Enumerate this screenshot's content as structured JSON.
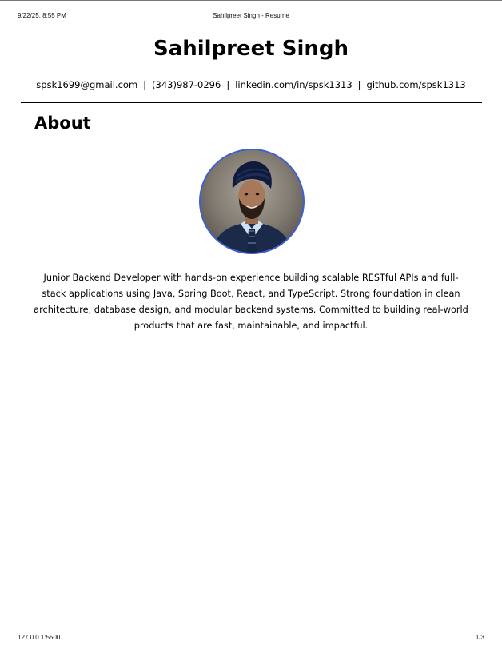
{
  "print_header": {
    "datetime": "9/22/25, 8:55 PM",
    "title": "Sahilpreet Singh - Resume"
  },
  "profile": {
    "name": "Sahilpreet Singh",
    "contacts": {
      "email": "spsk1699@gmail.com",
      "phone": "(343)987-0296",
      "linkedin": "linkedin.com/in/spsk1313",
      "github": "github.com/spsk1313",
      "separator": "|"
    }
  },
  "about": {
    "heading": "About",
    "photo_icon": "profile-photo",
    "photo_border_color": "#3d5fd6",
    "text": "Junior Backend Developer with hands-on experience building scalable RESTful APIs and full-stack applications using Java, Spring Boot, React, and TypeScript. Strong foundation in clean architecture, database design, and modular backend systems. Committed to building real-world products that are fast, maintainable, and impactful."
  },
  "print_footer": {
    "url": "127.0.0.1:5500",
    "page": "1/3"
  }
}
